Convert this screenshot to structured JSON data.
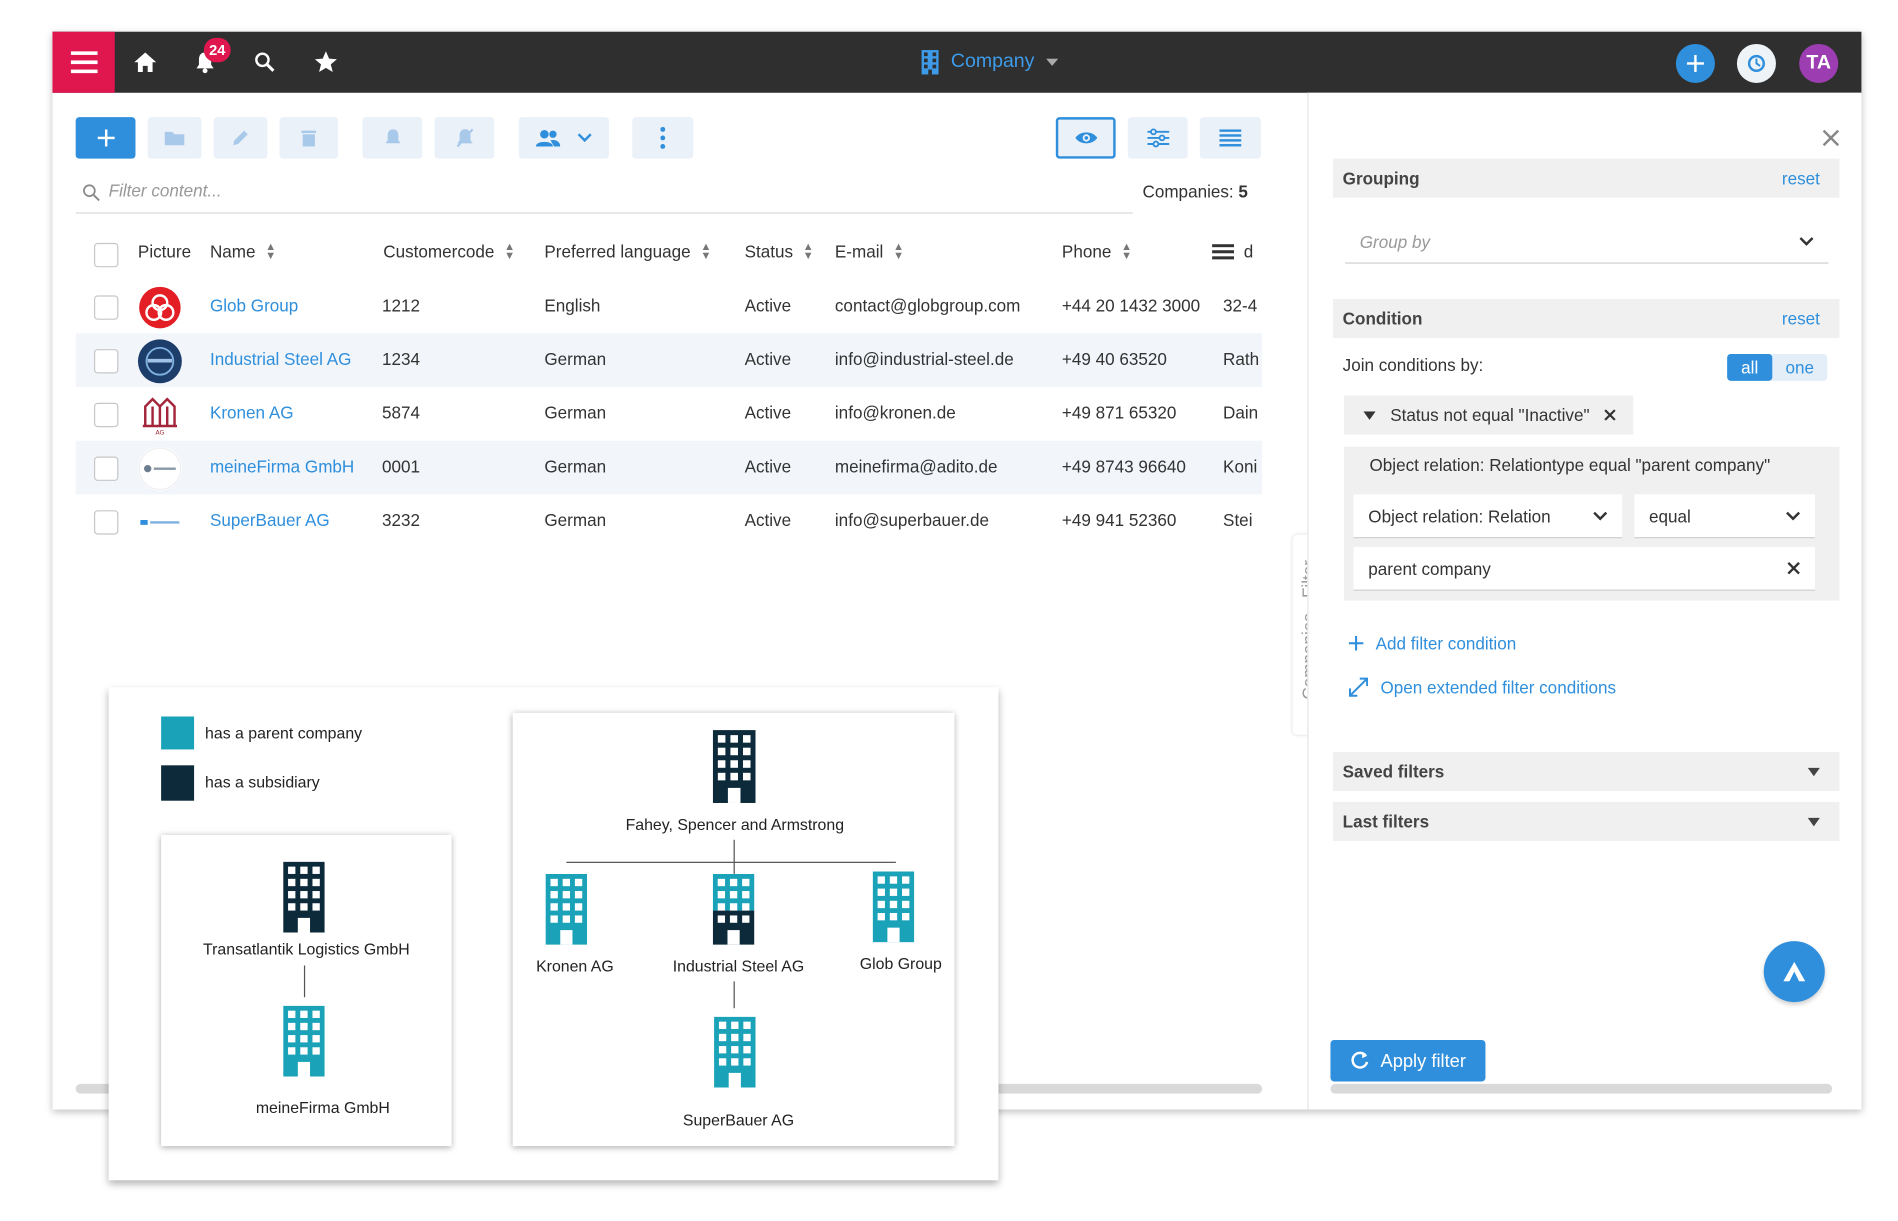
{
  "topbar": {
    "notification_count": "24",
    "context_title": "Company",
    "user_initials": "TA",
    "colors": {
      "bar": "#2f2f2f",
      "menu": "#e0174f",
      "accent": "#2f8fdc",
      "avatar": "#9c3eb1"
    }
  },
  "list": {
    "filter_placeholder": "Filter content...",
    "count_label": "Companies: ",
    "count_value": "5",
    "columns": [
      "Picture",
      "Name",
      "Customercode",
      "Preferred language",
      "Status",
      "E-mail",
      "Phone",
      "d"
    ],
    "rows": [
      {
        "name": "Glob Group",
        "code": "1212",
        "language": "English",
        "status": "Active",
        "email": "contact@globgroup.com",
        "phone": "+44 20 1432 3000",
        "address": "32-4"
      },
      {
        "name": "Industrial Steel AG",
        "code": "1234",
        "language": "German",
        "status": "Active",
        "email": "info@industrial-steel.de",
        "phone": "+49 40 63520",
        "address": "Rath"
      },
      {
        "name": "Kronen AG",
        "code": "5874",
        "language": "German",
        "status": "Active",
        "email": "info@kronen.de",
        "phone": "+49 871 65320",
        "address": "Dain"
      },
      {
        "name": "meineFirma GmbH",
        "code": "0001",
        "language": "German",
        "status": "Active",
        "email": "meinefirma@adito.de",
        "phone": "+49 8743 96640",
        "address": "Koni"
      },
      {
        "name": "SuperBauer AG",
        "code": "3232",
        "language": "German",
        "status": "Active",
        "email": "info@superbauer.de",
        "phone": "+49 941 52360",
        "address": "Stei"
      }
    ]
  },
  "filter_panel": {
    "tab_label": "Companies - Filter",
    "grouping_title": "Grouping",
    "reset_label": "reset",
    "group_by_placeholder": "Group by",
    "condition_title": "Condition",
    "join_label": "Join conditions by:",
    "join_all": "all",
    "join_one": "one",
    "condition_1": "Status not equal \"Inactive\"",
    "condition_2": "Object relation: Relationtype equal \"parent company\"",
    "field_select": "Object relation: Relation",
    "operator_select": "equal",
    "value_input": "parent company",
    "add_condition": "Add filter condition",
    "extended_conditions": "Open extended filter conditions",
    "saved_filters": "Saved filters",
    "last_filters": "Last filters",
    "apply_label": "Apply filter"
  },
  "diagram": {
    "legend": [
      {
        "label": "has a parent company",
        "color": "#1aa3b8"
      },
      {
        "label": "has a subsidiary",
        "color": "#0d2a3a"
      }
    ],
    "left_tree": {
      "parent": "Transatlantik Logistics GmbH",
      "child": "meineFirma GmbH"
    },
    "right_tree": {
      "root": "Fahey, Spencer and Armstrong",
      "children": [
        "Kronen AG",
        "Industrial Steel AG",
        "Glob Group"
      ],
      "grandchild": "SuperBauer AG"
    }
  }
}
